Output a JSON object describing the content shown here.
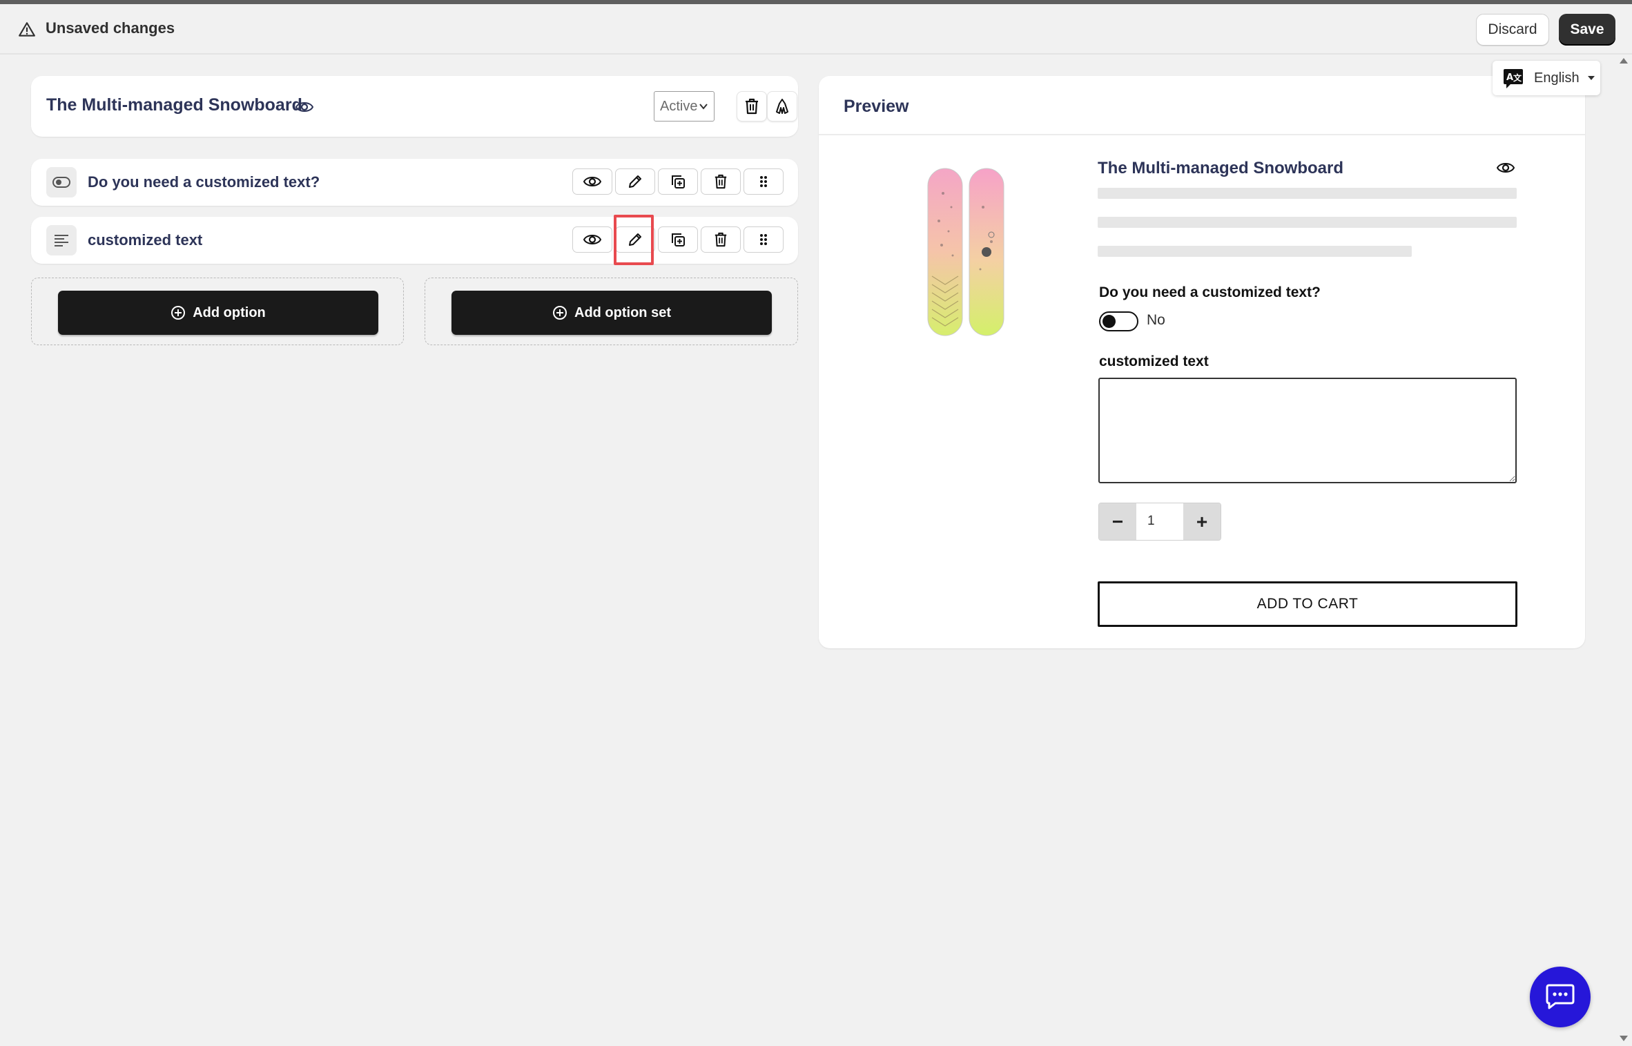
{
  "savebar": {
    "title": "Unsaved changes",
    "discard_label": "Discard",
    "save_label": "Save"
  },
  "language": {
    "label": "English",
    "icon": "translate-icon"
  },
  "product": {
    "title": "The Multi-managed Snowboard",
    "status": "Active"
  },
  "options": [
    {
      "label": "Do you need a customized text?",
      "icon": "toggle-icon"
    },
    {
      "label": "customized text",
      "icon": "text-lines-icon"
    }
  ],
  "actions": {
    "add_option": "Add option",
    "add_option_set": "Add option set"
  },
  "preview": {
    "heading": "Preview",
    "product_title": "The Multi-managed Snowboard",
    "question_label": "Do you need a customized text?",
    "toggle_state": "No",
    "text_label": "customized text",
    "quantity": "1",
    "minus": "−",
    "plus": "+",
    "add_to_cart": "ADD TO CART"
  },
  "colors": {
    "primary_dark": "#303030",
    "title_navy": "#2d3458",
    "highlight": "#e84a4f",
    "chat": "#2617d9"
  }
}
